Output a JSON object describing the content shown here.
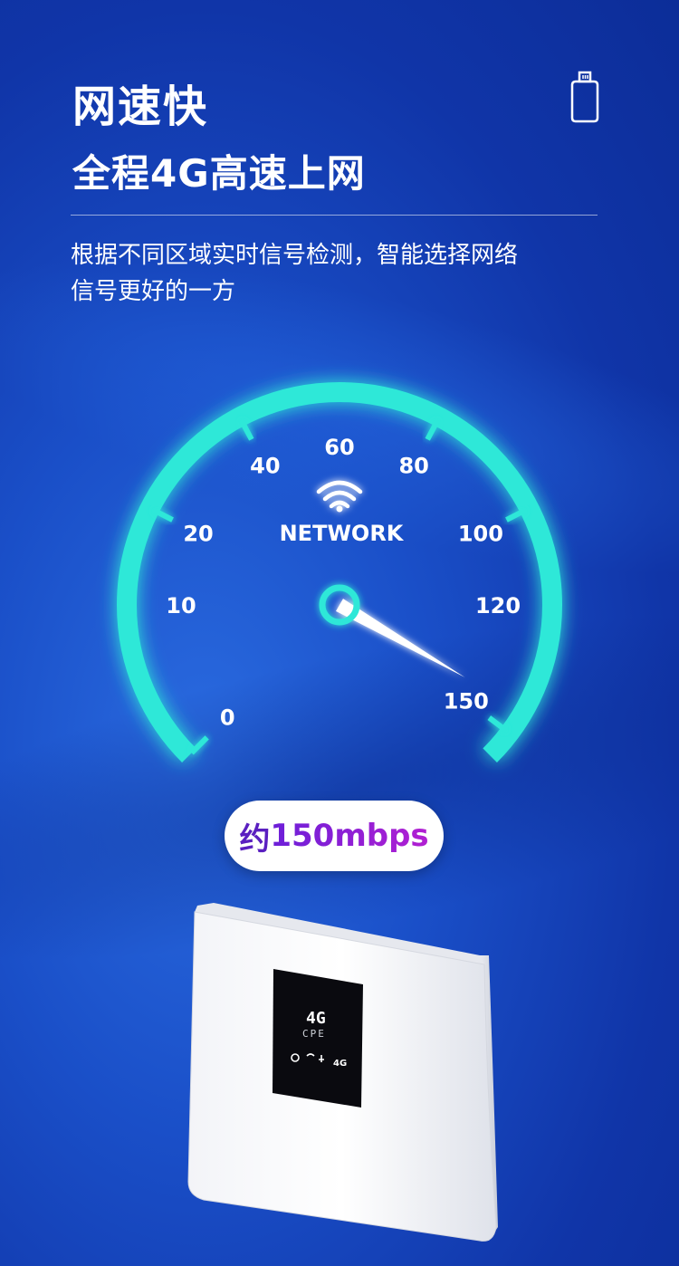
{
  "header": {
    "title": "网速快",
    "subtitle": "全程4G高速上网",
    "description_line1": "根据不同区域实时信号检测，智能选择网络",
    "description_line2": "信号更好的一方"
  },
  "icons": {
    "sim": "sim-card-icon",
    "wifi": "wifi-icon"
  },
  "gauge": {
    "label": "NETWORK",
    "ticks": [
      "0",
      "10",
      "20",
      "40",
      "60",
      "80",
      "100",
      "120",
      "150"
    ],
    "needle_value": 150,
    "color": "#2de8d8"
  },
  "speed": {
    "prefix": "约",
    "value": "150mbps"
  },
  "device": {
    "screen_text_top": "4G",
    "screen_text_bottom": "CPE",
    "indicator_label": "4G"
  }
}
